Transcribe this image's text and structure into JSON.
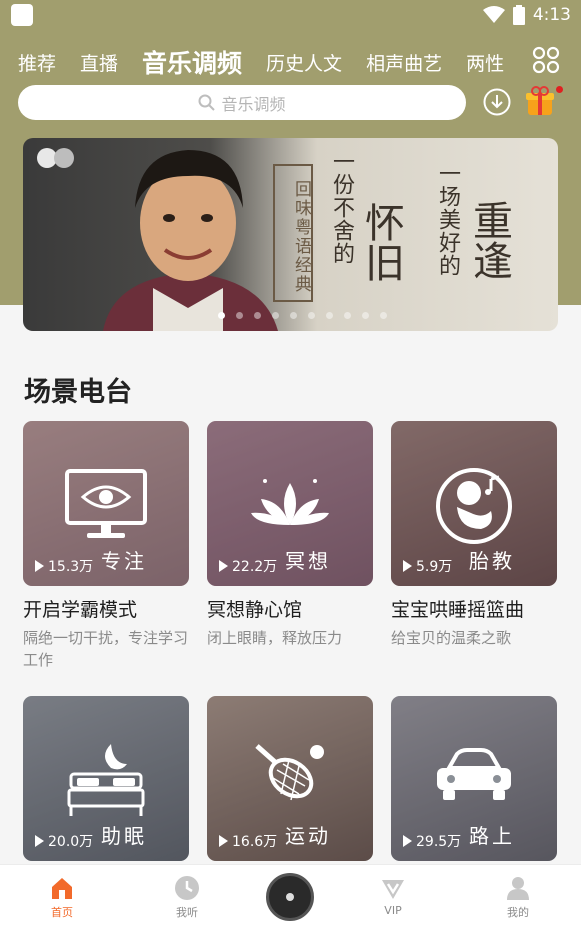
{
  "status_bar": {
    "time": "4:13"
  },
  "tabs": [
    {
      "label": "推荐"
    },
    {
      "label": "直播"
    },
    {
      "label": "音乐调频"
    },
    {
      "label": "历史人文"
    },
    {
      "label": "相声曲艺"
    },
    {
      "label": "两性"
    }
  ],
  "search": {
    "placeholder": "音乐调频"
  },
  "banner": {
    "vertical_label": "回味粤语经典",
    "line1": "一份不舍的",
    "line1_big": "怀旧",
    "line2": "一场美好的",
    "line2_big": "重逢",
    "page_count": 10,
    "active_page": 1
  },
  "section": {
    "title": "场景电台"
  },
  "cards": [
    {
      "plays": "15.3万",
      "tag": "专注",
      "title": "开启学霸模式",
      "subtitle": "隔绝一切干扰，专注学习工作",
      "icon": "monitor-eye-icon",
      "color": "#b89a9c"
    },
    {
      "plays": "22.2万",
      "tag": "冥想",
      "title": "冥想静心馆",
      "subtitle": "闭上眼睛，释放压力",
      "icon": "lotus-icon",
      "color": "#a67f90"
    },
    {
      "plays": "5.9万",
      "tag": "胎教",
      "title": "宝宝哄睡摇篮曲",
      "subtitle": "给宝贝的温柔之歌",
      "icon": "baby-icon",
      "color": "#8e6e6a"
    },
    {
      "plays": "20.0万",
      "tag": "助眠",
      "title": "",
      "subtitle": "",
      "icon": "bed-moon-icon",
      "color": "#7d8a92"
    },
    {
      "plays": "16.6万",
      "tag": "运动",
      "title": "",
      "subtitle": "",
      "icon": "tennis-icon",
      "color": "#9a8a7c"
    },
    {
      "plays": "29.5万",
      "tag": "路上",
      "title": "",
      "subtitle": "",
      "icon": "car-icon",
      "color": "#8a8f96"
    }
  ],
  "bottom_nav": [
    {
      "label": "首页",
      "icon": "home-icon",
      "active": true
    },
    {
      "label": "我听",
      "icon": "clock-icon",
      "active": false
    },
    {
      "label": "",
      "icon": "disc-icon",
      "active": false
    },
    {
      "label": "VIP",
      "icon": "vip-icon",
      "active": false
    },
    {
      "label": "我的",
      "icon": "user-icon",
      "active": false
    }
  ],
  "colors": {
    "header_bg": "#a19e6e",
    "accent": "#f26a2b"
  }
}
